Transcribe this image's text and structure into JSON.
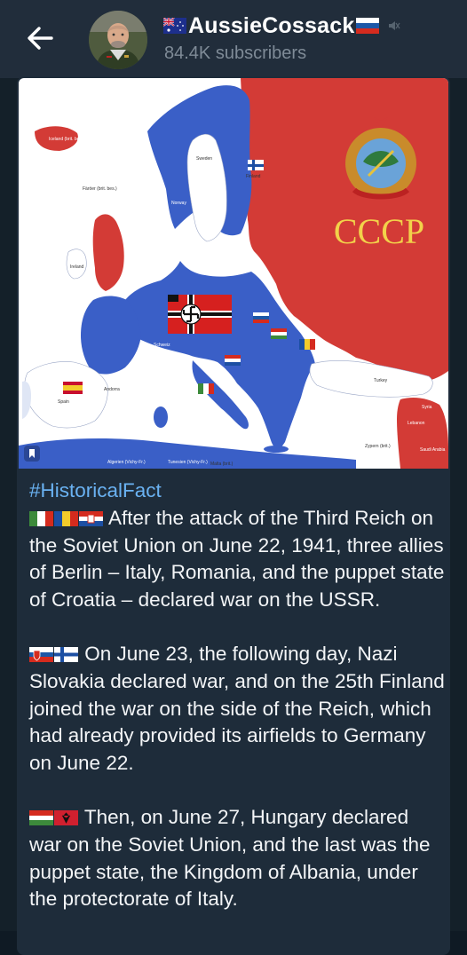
{
  "header": {
    "title": "AussieCossack",
    "subtitle": "84.4K subscribers"
  },
  "map": {
    "ussr_label": "CCCP",
    "labels": {
      "sweden": "Sweden",
      "finland": "Finland",
      "norway": "Norway",
      "ireland": "Ireland",
      "spain": "Spain",
      "andorra": "Andorra",
      "turkey": "Turkey",
      "lebanon": "Lebanon",
      "syria": "Syria",
      "saudi": "Saudi Arabia",
      "malta": "Malta (brit.)",
      "iceland": "Iceland (brit. bes.)",
      "faroe": "Färöer (brit. bes.)",
      "cyprus": "Zypern (brit.)",
      "switzerland": "Schweiz",
      "algeria": "Algerien (Vichy-Fr.)",
      "tunisia": "Tunesien (Vichy-Fr.)"
    },
    "colors": {
      "sea": "#ffffff",
      "axis": "#3a5fc7",
      "ussr": "#d33b36",
      "allies": "#d33b36",
      "neutral": "#ffffff"
    }
  },
  "message": {
    "hashtag": "#HistoricalFact",
    "paragraphs": [
      " After the attack of the Third Reich on the Soviet Union on June 22, 1941, three allies of Berlin – Italy, Romania, and the puppet state of Croatia – declared war on the USSR.",
      " On June 23, the following day, Nazi Slovakia declared war, and on the 25th Finland joined the war on the side of the Reich, which had already provided its airfields to Germany on June 22.",
      " Then, on June 27, Hungary declared war on the Soviet Union, and the last was the puppet state, the Kingdom of Albania, under the protectorate of Italy."
    ]
  }
}
